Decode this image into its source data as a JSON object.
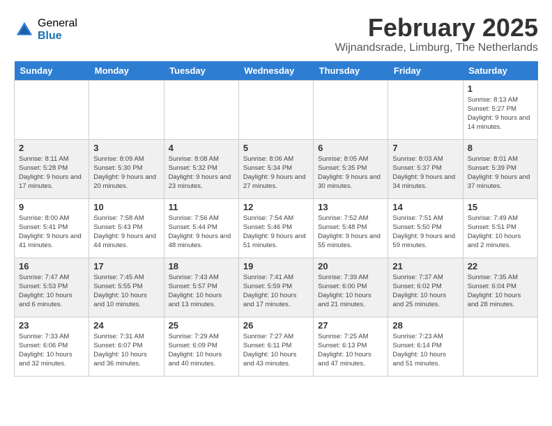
{
  "header": {
    "logo_general": "General",
    "logo_blue": "Blue",
    "month_title": "February 2025",
    "location": "Wijnandsrade, Limburg, The Netherlands"
  },
  "weekdays": [
    "Sunday",
    "Monday",
    "Tuesday",
    "Wednesday",
    "Thursday",
    "Friday",
    "Saturday"
  ],
  "rows": [
    {
      "cells": [
        {
          "day": "",
          "info": ""
        },
        {
          "day": "",
          "info": ""
        },
        {
          "day": "",
          "info": ""
        },
        {
          "day": "",
          "info": ""
        },
        {
          "day": "",
          "info": ""
        },
        {
          "day": "",
          "info": ""
        },
        {
          "day": "1",
          "info": "Sunrise: 8:13 AM\nSunset: 5:27 PM\nDaylight: 9 hours\nand 14 minutes."
        }
      ]
    },
    {
      "cells": [
        {
          "day": "2",
          "info": "Sunrise: 8:11 AM\nSunset: 5:28 PM\nDaylight: 9 hours\nand 17 minutes."
        },
        {
          "day": "3",
          "info": "Sunrise: 8:09 AM\nSunset: 5:30 PM\nDaylight: 9 hours\nand 20 minutes."
        },
        {
          "day": "4",
          "info": "Sunrise: 8:08 AM\nSunset: 5:32 PM\nDaylight: 9 hours\nand 23 minutes."
        },
        {
          "day": "5",
          "info": "Sunrise: 8:06 AM\nSunset: 5:34 PM\nDaylight: 9 hours\nand 27 minutes."
        },
        {
          "day": "6",
          "info": "Sunrise: 8:05 AM\nSunset: 5:35 PM\nDaylight: 9 hours\nand 30 minutes."
        },
        {
          "day": "7",
          "info": "Sunrise: 8:03 AM\nSunset: 5:37 PM\nDaylight: 9 hours\nand 34 minutes."
        },
        {
          "day": "8",
          "info": "Sunrise: 8:01 AM\nSunset: 5:39 PM\nDaylight: 9 hours\nand 37 minutes."
        }
      ]
    },
    {
      "cells": [
        {
          "day": "9",
          "info": "Sunrise: 8:00 AM\nSunset: 5:41 PM\nDaylight: 9 hours\nand 41 minutes."
        },
        {
          "day": "10",
          "info": "Sunrise: 7:58 AM\nSunset: 5:43 PM\nDaylight: 9 hours\nand 44 minutes."
        },
        {
          "day": "11",
          "info": "Sunrise: 7:56 AM\nSunset: 5:44 PM\nDaylight: 9 hours\nand 48 minutes."
        },
        {
          "day": "12",
          "info": "Sunrise: 7:54 AM\nSunset: 5:46 PM\nDaylight: 9 hours\nand 51 minutes."
        },
        {
          "day": "13",
          "info": "Sunrise: 7:52 AM\nSunset: 5:48 PM\nDaylight: 9 hours\nand 55 minutes."
        },
        {
          "day": "14",
          "info": "Sunrise: 7:51 AM\nSunset: 5:50 PM\nDaylight: 9 hours\nand 59 minutes."
        },
        {
          "day": "15",
          "info": "Sunrise: 7:49 AM\nSunset: 5:51 PM\nDaylight: 10 hours\nand 2 minutes."
        }
      ]
    },
    {
      "cells": [
        {
          "day": "16",
          "info": "Sunrise: 7:47 AM\nSunset: 5:53 PM\nDaylight: 10 hours\nand 6 minutes."
        },
        {
          "day": "17",
          "info": "Sunrise: 7:45 AM\nSunset: 5:55 PM\nDaylight: 10 hours\nand 10 minutes."
        },
        {
          "day": "18",
          "info": "Sunrise: 7:43 AM\nSunset: 5:57 PM\nDaylight: 10 hours\nand 13 minutes."
        },
        {
          "day": "19",
          "info": "Sunrise: 7:41 AM\nSunset: 5:59 PM\nDaylight: 10 hours\nand 17 minutes."
        },
        {
          "day": "20",
          "info": "Sunrise: 7:39 AM\nSunset: 6:00 PM\nDaylight: 10 hours\nand 21 minutes."
        },
        {
          "day": "21",
          "info": "Sunrise: 7:37 AM\nSunset: 6:02 PM\nDaylight: 10 hours\nand 25 minutes."
        },
        {
          "day": "22",
          "info": "Sunrise: 7:35 AM\nSunset: 6:04 PM\nDaylight: 10 hours\nand 28 minutes."
        }
      ]
    },
    {
      "cells": [
        {
          "day": "23",
          "info": "Sunrise: 7:33 AM\nSunset: 6:06 PM\nDaylight: 10 hours\nand 32 minutes."
        },
        {
          "day": "24",
          "info": "Sunrise: 7:31 AM\nSunset: 6:07 PM\nDaylight: 10 hours\nand 36 minutes."
        },
        {
          "day": "25",
          "info": "Sunrise: 7:29 AM\nSunset: 6:09 PM\nDaylight: 10 hours\nand 40 minutes."
        },
        {
          "day": "26",
          "info": "Sunrise: 7:27 AM\nSunset: 6:11 PM\nDaylight: 10 hours\nand 43 minutes."
        },
        {
          "day": "27",
          "info": "Sunrise: 7:25 AM\nSunset: 6:13 PM\nDaylight: 10 hours\nand 47 minutes."
        },
        {
          "day": "28",
          "info": "Sunrise: 7:23 AM\nSunset: 6:14 PM\nDaylight: 10 hours\nand 51 minutes."
        },
        {
          "day": "",
          "info": ""
        }
      ]
    }
  ]
}
